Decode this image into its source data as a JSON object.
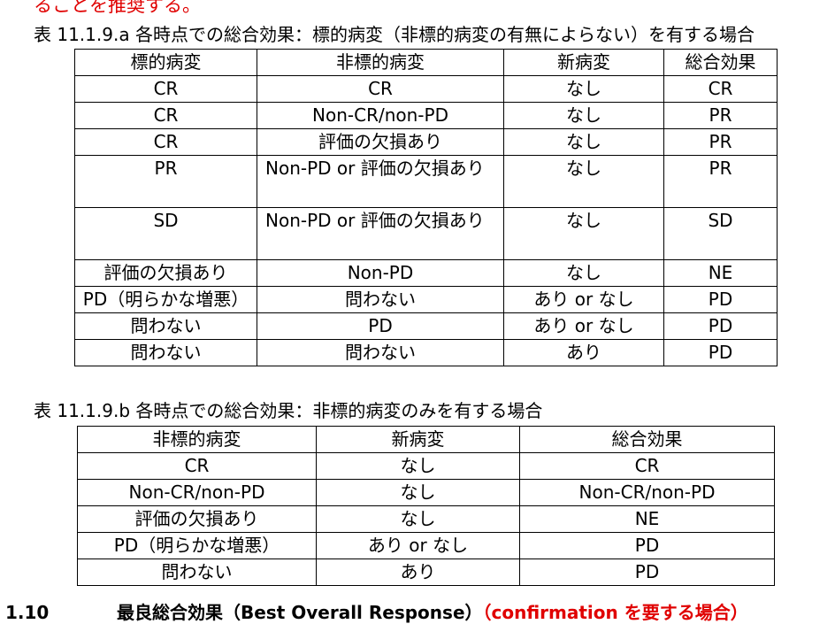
{
  "top_note": "ることを推奨する。",
  "table_a": {
    "caption": "表 11.1.9.a 各時点での総合効果：標的病変（非標的病変の有無によらない）を有する場合",
    "headers": [
      "標的病変",
      "非標的病変",
      "新病変",
      "総合効果"
    ],
    "rows": [
      [
        "CR",
        "CR",
        "なし",
        "CR"
      ],
      [
        "CR",
        "Non-CR/non-PD",
        "なし",
        "PR"
      ],
      [
        "CR",
        "評価の欠損あり",
        "なし",
        "PR"
      ],
      [
        "PR",
        "Non-PD or 評価の欠損あり",
        "なし",
        "PR"
      ],
      [
        "SD",
        "Non-PD or 評価の欠損あり",
        "なし",
        "SD"
      ],
      [
        "評価の欠損あり",
        "Non-PD",
        "なし",
        "NE"
      ],
      [
        "PD（明らかな増悪）",
        "問わない",
        "あり or なし",
        "PD"
      ],
      [
        "問わない",
        "PD",
        "あり or なし",
        "PD"
      ],
      [
        "問わない",
        "問わない",
        "あり",
        "PD"
      ]
    ]
  },
  "table_b": {
    "caption": "表 11.1.9.b 各時点での総合効果：非標的病変のみを有する場合",
    "headers": [
      "非標的病変",
      "新病変",
      "総合効果"
    ],
    "rows": [
      [
        "CR",
        "なし",
        "CR"
      ],
      [
        "Non-CR/non-PD",
        "なし",
        "Non-CR/non-PD"
      ],
      [
        "評価の欠損あり",
        "なし",
        "NE"
      ],
      [
        "PD（明らかな増悪）",
        "あり or なし",
        "PD"
      ],
      [
        "問わない",
        "あり",
        "PD"
      ]
    ]
  },
  "next_section": {
    "number": "1.10",
    "title": "最良総合効果（Best Overall Response）",
    "note": "（confirmation を要する場合）"
  },
  "colors": {
    "accent_red": "#e00000",
    "text": "#000000",
    "border": "#000000"
  }
}
